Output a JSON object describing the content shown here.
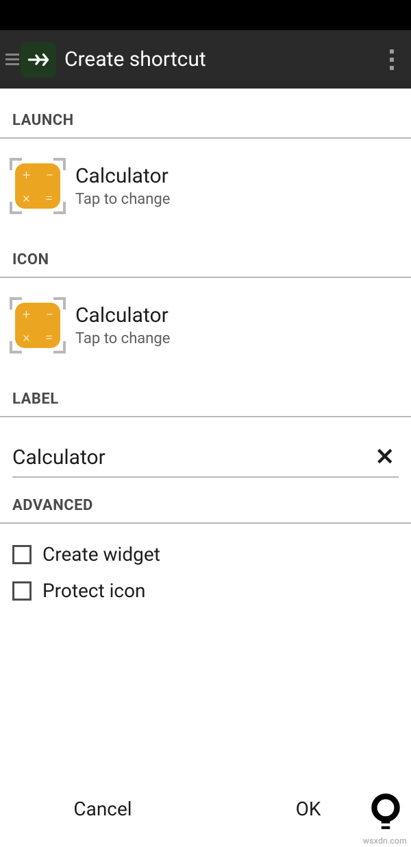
{
  "header": {
    "title": "Create shortcut"
  },
  "sections": {
    "launch": {
      "header": "LAUNCH",
      "item": {
        "title": "Calculator",
        "subtitle": "Tap to change"
      }
    },
    "icon": {
      "header": "ICON",
      "item": {
        "title": "Calculator",
        "subtitle": "Tap to change"
      }
    },
    "label": {
      "header": "LABEL",
      "value": "Calculator"
    },
    "advanced": {
      "header": "ADVANCED",
      "create_widget": "Create widget",
      "protect_icon": "Protect icon"
    }
  },
  "footer": {
    "cancel": "Cancel",
    "ok": "OK"
  },
  "watermark": "wsxdn.com"
}
